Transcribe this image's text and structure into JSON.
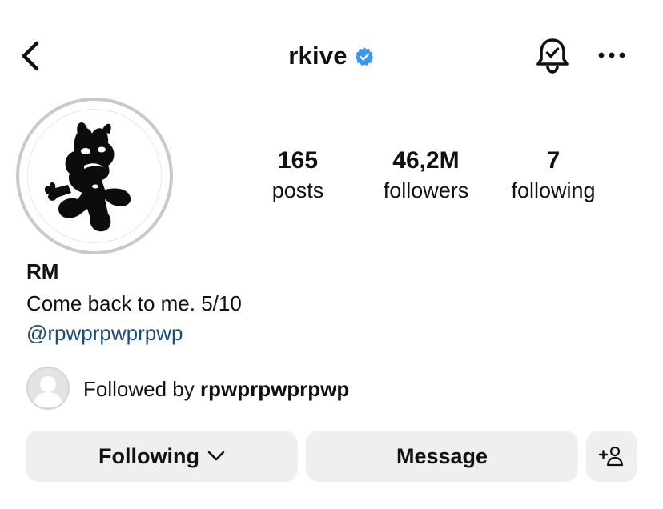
{
  "header": {
    "back_icon": "chevron-left-icon",
    "username": "rkive",
    "verified_icon": "verified-badge-icon",
    "verified_color": "#3897f0",
    "bell_icon": "notification-bell-check-icon",
    "more_icon": "more-horizontal-icon"
  },
  "profile": {
    "avatar_icon": "profile-picture",
    "stats": [
      {
        "value": "165",
        "label": "posts"
      },
      {
        "value": "46,2M",
        "label": "followers"
      },
      {
        "value": "7",
        "label": "following"
      }
    ],
    "name": "RM",
    "bio": "Come back to me. 5/10",
    "link": "@rpwprpwprpwp",
    "link_color": "#1f4d7a"
  },
  "followed_by": {
    "prefix": "Followed by",
    "user": "rpwprpwprpwp"
  },
  "actions": {
    "following_label": "Following",
    "message_label": "Message",
    "add_user_icon": "add-person-icon"
  }
}
